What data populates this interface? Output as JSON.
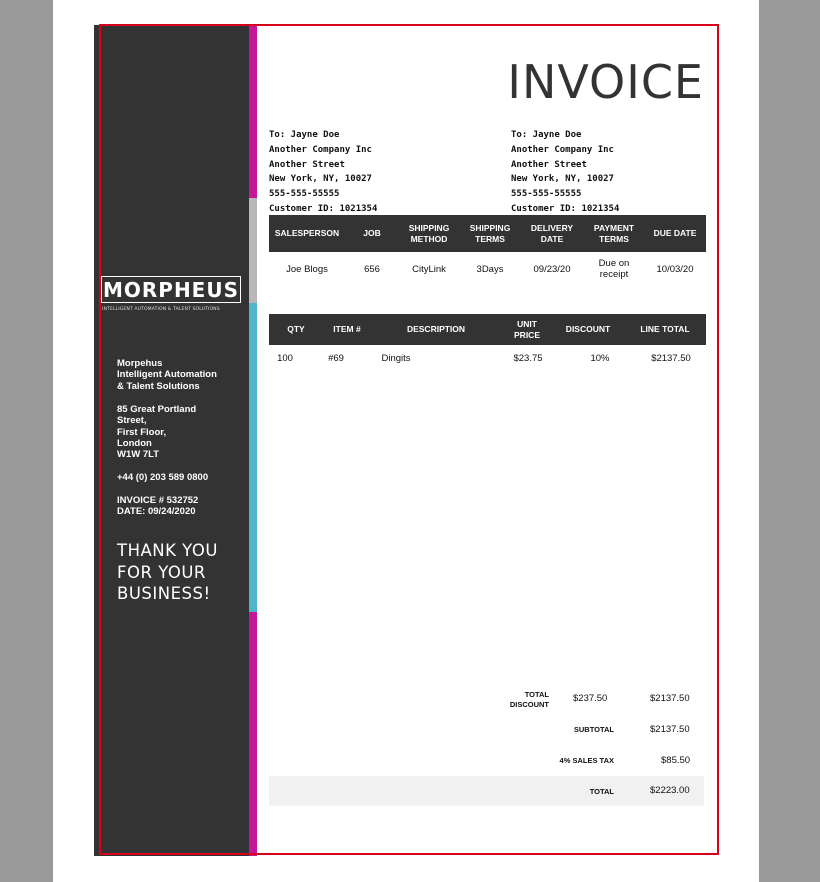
{
  "colors": {
    "sidebar": "#333333",
    "accent_magenta": "#c4169b",
    "accent_gray": "#b7b7b7",
    "accent_teal": "#4fb5cc",
    "frame_red": "#d9001b"
  },
  "brand": {
    "logo": "MORPHEUS",
    "tagline": "INTELLIGENT AUTOMATION & TALENT SOLUTIONS"
  },
  "sidebar": {
    "company": [
      "Morpehus",
      "Intelligent Automation",
      "& Talent Solutions"
    ],
    "address": [
      "85 Great Portland",
      "Street,",
      "First Floor,",
      "London",
      "W1W 7LT"
    ],
    "phone": "+44 (0) 203 589 0800",
    "invoice_no": "INVOICE # 532752",
    "date": "DATE: 09/24/2020",
    "thanks": [
      "THANK YOU",
      "FOR YOUR",
      "BUSINESS!"
    ]
  },
  "title": "INVOICE",
  "bill_to": [
    "To: Jayne Doe",
    "Another  Company Inc",
    "Another  Street",
    "New York, NY, 10027",
    "555-555-55555",
    "Customer ID: 1021354"
  ],
  "ship_to": [
    "To: Jayne Doe",
    "Another  Company Inc",
    "Another  Street",
    "New York, NY, 10027",
    "555-555-55555",
    "Customer ID: 1021354"
  ],
  "info_table": {
    "headers": [
      [
        "SALESPERSON"
      ],
      [
        "JOB"
      ],
      [
        "SHIPPING",
        "METHOD"
      ],
      [
        "SHIPPING",
        "TERMS"
      ],
      [
        "DELIVERY",
        "DATE"
      ],
      [
        "PAYMENT",
        "TERMS"
      ],
      [
        "DUE DATE"
      ]
    ],
    "row": [
      [
        "Joe Blogs"
      ],
      [
        "656"
      ],
      [
        "CityLink"
      ],
      [
        "3Days"
      ],
      [
        "09/23/20"
      ],
      [
        "Due on",
        "receipt"
      ],
      [
        "10/03/20"
      ]
    ]
  },
  "items_table": {
    "headers": [
      [
        "QTY"
      ],
      [
        "ITEM #"
      ],
      [
        "DESCRIPTION"
      ],
      [
        "UNIT",
        "PRICE"
      ],
      [
        "DISCOUNT"
      ],
      [
        "LINE TOTAL"
      ]
    ],
    "rows": [
      [
        "100",
        "#69",
        "Dingits",
        "$23.75",
        "10%",
        "$2137.50"
      ]
    ]
  },
  "totals": {
    "discount_label": [
      "TOTAL",
      "DISCOUNT"
    ],
    "discount_value": "$237.50",
    "discount_line": "$2137.50",
    "subtotal_label": "SUBTOTAL",
    "subtotal_value": "$2137.50",
    "tax_label": "4% SALES TAX",
    "tax_value": "$85.50",
    "total_label": "TOTAL",
    "total_value": "$2223.00"
  }
}
